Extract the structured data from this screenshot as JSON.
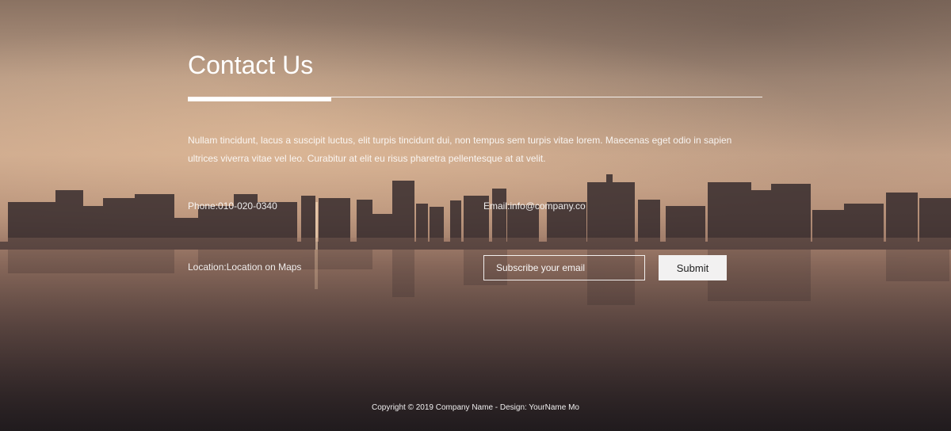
{
  "contact": {
    "title": "Contact Us",
    "description": "Nullam tincidunt, lacus a suscipit luctus, elit turpis tincidunt dui, non tempus sem turpis vitae lorem. Maecenas eget odio in sapien ultrices viverra vitae vel leo. Curabitur at elit eu risus pharetra pellentesque at at velit.",
    "phone": {
      "label": "Phone:",
      "value": "010-020-0340"
    },
    "email": {
      "label": "Email:",
      "value": "info@company.co"
    },
    "location": {
      "label": "Location:",
      "value": "Location on Maps"
    }
  },
  "subscribe": {
    "placeholder": "Subscribe your email",
    "submit_label": "Submit"
  },
  "footer": {
    "copyright": "Copyright © 2019 Company Name - Design: YourName Mo"
  },
  "colors": {
    "text": "#ffffff",
    "button_bg": "#f2f1f1",
    "button_text": "#222222"
  }
}
